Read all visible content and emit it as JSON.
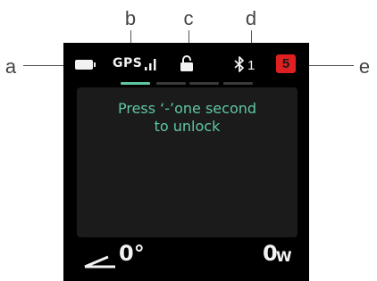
{
  "callouts": {
    "a": "a",
    "b": "b",
    "c": "c",
    "d": "d",
    "e": "e"
  },
  "status_bar": {
    "gps_label": "GPS",
    "bluetooth_count": "1",
    "notification_count": "5",
    "icons": [
      "battery-icon",
      "signal-bars-icon",
      "lock-icon",
      "bluetooth-icon"
    ]
  },
  "page_indicator": {
    "pages": 4,
    "active_index": 0
  },
  "message": {
    "line1": "Press ‘-’one second",
    "line2": "to unlock"
  },
  "metrics": {
    "angle_value": "0°",
    "power_value": "0",
    "power_unit": "W"
  },
  "colors": {
    "accent": "#5fc7a6",
    "badge": "#e02020",
    "screen": "#000000",
    "panel": "#1b1b1b"
  }
}
